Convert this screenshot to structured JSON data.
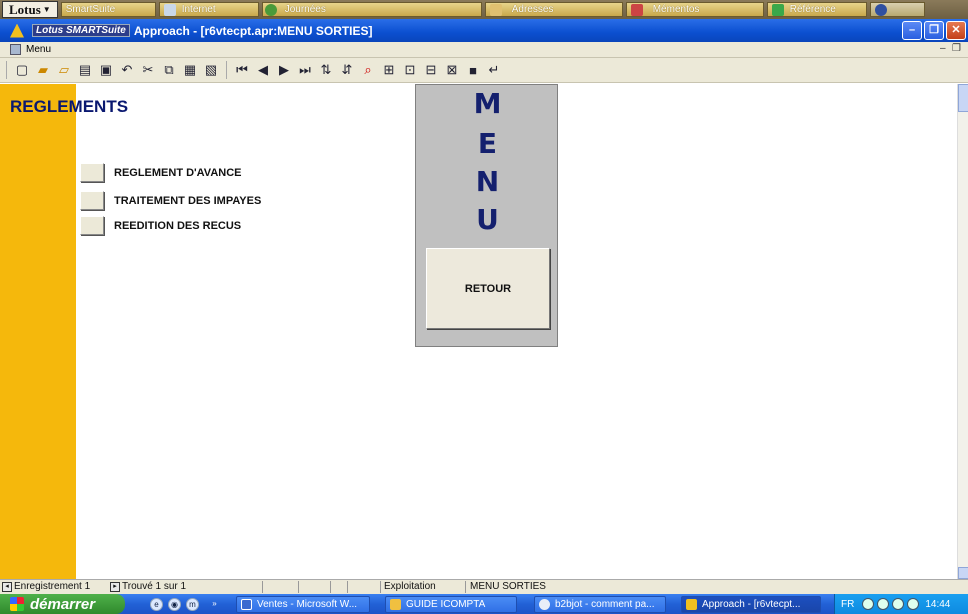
{
  "smartsuite": {
    "lotus_label": "Lotus",
    "drawers": [
      {
        "label": "SmartSuite"
      },
      {
        "label": "Internet"
      },
      {
        "label": "Journées"
      },
      {
        "label": "Adresses"
      },
      {
        "label": "Mémentos"
      },
      {
        "label": "Référence"
      }
    ]
  },
  "window": {
    "brand": "Lotus SMARTSuite",
    "title": "Approach - [r6vtecpt.apr:MENU SORTIES]"
  },
  "doc": {
    "menu_label": "Menu"
  },
  "form": {
    "heading": "REGLEMENTS",
    "menu_items": [
      {
        "label": "REGLEMENT D'AVANCE"
      },
      {
        "label": "TRAITEMENT DES  IMPAYES"
      },
      {
        "label": "REEDITION DES RECUS"
      }
    ],
    "menu_letters": [
      "M",
      "E",
      "N",
      "U"
    ],
    "retour_label": "RETOUR"
  },
  "status": {
    "record": "Enregistrement 1",
    "found": "Trouvé 1 sur 1",
    "mode": "Exploitation",
    "view": "MENU SORTIES"
  },
  "taskbar": {
    "start_label": "démarrer",
    "tasks": [
      {
        "label": "Ventes - Microsoft W..."
      },
      {
        "label": "GUIDE ICOMPTA"
      },
      {
        "label": "b2bjot - comment pa..."
      },
      {
        "label": "Approach - [r6vtecpt..."
      }
    ],
    "language": "FR",
    "clock": "14:44"
  },
  "colors": {
    "stripe": "#f5b80c",
    "heading": "#0a1870",
    "menu_panel": "#c0c0c0",
    "menu_letters": "#14206e",
    "titlebar": "#0b4fd0"
  }
}
